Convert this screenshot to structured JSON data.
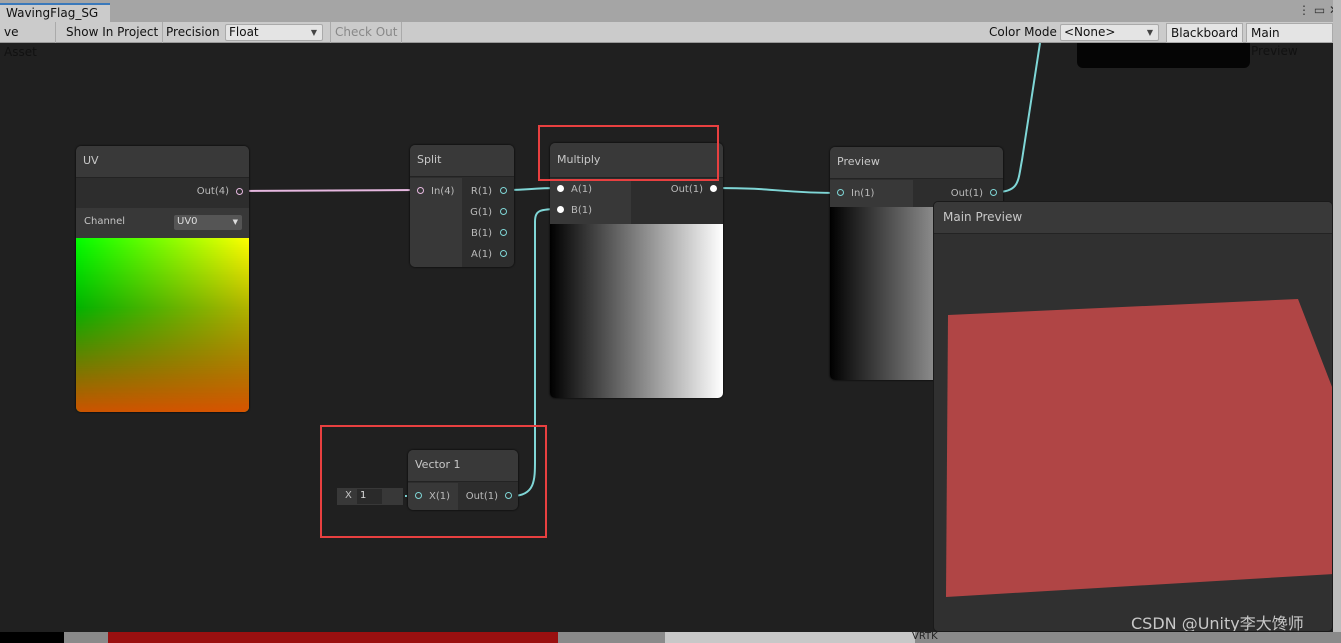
{
  "window": {
    "tab_title": "WavingFlag_SG"
  },
  "toolbar": {
    "save_asset": "ve Asset",
    "show_in_project": "Show In Project",
    "precision_label": "Precision",
    "precision_value": "Float",
    "check_out": "Check Out",
    "color_mode_label": "Color Mode",
    "color_mode_value": "<None>",
    "blackboard": "Blackboard",
    "main_preview": "Main Preview"
  },
  "nodes": {
    "uv": {
      "title": "UV",
      "out": "Out(4)",
      "channel_label": "Channel",
      "channel_value": "UV0"
    },
    "split": {
      "title": "Split",
      "in": "In(4)",
      "outs": [
        "R(1)",
        "G(1)",
        "B(1)",
        "A(1)"
      ]
    },
    "multiply": {
      "title": "Multiply",
      "a": "A(1)",
      "b": "B(1)",
      "out": "Out(1)"
    },
    "preview": {
      "title": "Preview",
      "in": "In(1)",
      "out": "Out(1)"
    },
    "vector1": {
      "title": "Vector 1",
      "field_label": "X",
      "field_value": "1",
      "in": "X(1)",
      "out": "Out(1)"
    }
  },
  "main_preview": {
    "title": "Main Preview",
    "mesh_color": "#b04545"
  },
  "watermark": "CSDN @Unity李大馋师",
  "bottom": {
    "label": "VRTK"
  },
  "colors": {
    "wire_float": "#7fd6d6",
    "wire_vec4": "#e6b8e0",
    "highlight": "#e84040"
  }
}
